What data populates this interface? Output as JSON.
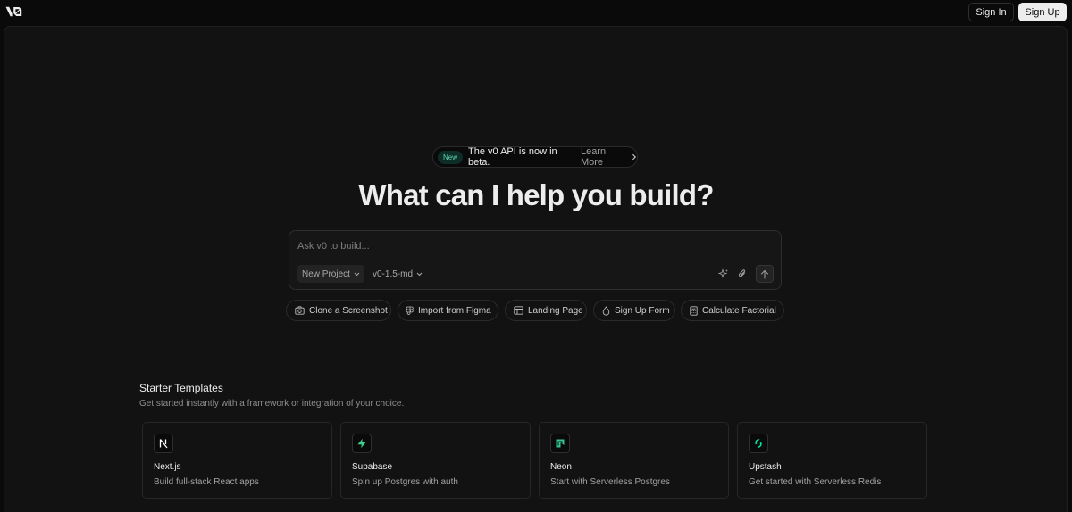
{
  "header": {
    "sign_in": "Sign In",
    "sign_up": "Sign Up"
  },
  "announcement": {
    "badge": "New",
    "text": "The v0 API is now in beta.",
    "link": "Learn More"
  },
  "hero": {
    "title": "What can I help you build?"
  },
  "prompt": {
    "placeholder": "Ask v0 to build...",
    "project_selector": "New Project",
    "model_selector": "v0-1.5-md"
  },
  "suggestions": [
    {
      "label": "Clone a Screenshot",
      "icon": "camera-icon"
    },
    {
      "label": "Import from Figma",
      "icon": "figma-icon"
    },
    {
      "label": "Landing Page",
      "icon": "layout-icon"
    },
    {
      "label": "Sign Up Form",
      "icon": "droplet-icon"
    },
    {
      "label": "Calculate Factorial",
      "icon": "calculator-icon"
    }
  ],
  "templates": {
    "title": "Starter Templates",
    "subtitle": "Get started instantly with a framework or integration of your choice.",
    "items": [
      {
        "name": "Next.js",
        "description": "Build full-stack React apps",
        "icon": "nextjs-icon",
        "color": "#ffffff"
      },
      {
        "name": "Supabase",
        "description": "Spin up Postgres with auth",
        "icon": "supabase-icon",
        "color": "#3ecf8e"
      },
      {
        "name": "Neon",
        "description": "Start with Serverless Postgres",
        "icon": "neon-icon",
        "color": "#37c38f"
      },
      {
        "name": "Upstash",
        "description": "Get started with Serverless Redis",
        "icon": "upstash-icon",
        "color": "#00e9a3"
      }
    ]
  },
  "colors": {
    "background": "#0a0a0a",
    "panel": "#121212",
    "badge_bg": "#0d2e26",
    "badge_text": "#5fd4b4"
  }
}
